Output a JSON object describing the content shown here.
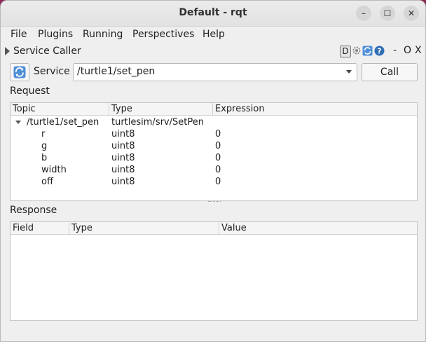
{
  "window": {
    "title": "Default - rqt",
    "controls": {
      "minimize": "–",
      "maximize": "☐",
      "close": "✕"
    }
  },
  "menubar": {
    "items": [
      {
        "label": "File"
      },
      {
        "label": "Plugins"
      },
      {
        "label": "Running"
      },
      {
        "label": "Perspectives"
      },
      {
        "label": "Help"
      }
    ]
  },
  "plugin": {
    "title": "Service Caller",
    "right_icons": {
      "d": "D",
      "minimize": "-",
      "restore": "O",
      "close": "X"
    }
  },
  "service": {
    "label": "Service",
    "selected": "/turtle1/set_pen",
    "call_label": "Call"
  },
  "request": {
    "label": "Request",
    "columns": [
      "Topic",
      "Type",
      "Expression"
    ],
    "root": {
      "topic": "/turtle1/set_pen",
      "type": "turtlesim/srv/SetPen",
      "expression": ""
    },
    "rows": [
      {
        "topic": "r",
        "type": "uint8",
        "expression": "0"
      },
      {
        "topic": "g",
        "type": "uint8",
        "expression": "0"
      },
      {
        "topic": "b",
        "type": "uint8",
        "expression": "0"
      },
      {
        "topic": "width",
        "type": "uint8",
        "expression": "0"
      },
      {
        "topic": "off",
        "type": "uint8",
        "expression": "0"
      }
    ]
  },
  "response": {
    "label": "Response",
    "columns": [
      "Field",
      "Type",
      "Value"
    ]
  }
}
